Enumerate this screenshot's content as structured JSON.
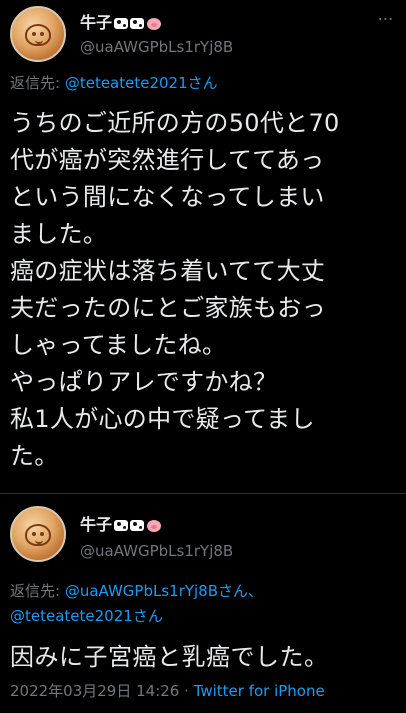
{
  "tweet1": {
    "name": "牛子",
    "handle": "@uaAWGPbLs1rYj8B",
    "reply_prefix": "返信先: ",
    "reply_to": "@teteatete2021",
    "reply_suffix": "さん",
    "lines": [
      "うちのご近所の方の50代と70",
      "代が癌が突然進行しててあっ",
      "という間になくなってしまい",
      "ました。",
      "癌の症状は落ち着いてて大丈",
      "夫だったのにとご家族もおっ",
      "しゃってましたね。",
      "やっぱりアレですかね？",
      "私1人が心の中で疑ってまし",
      "た。"
    ]
  },
  "tweet2": {
    "name": "牛子",
    "handle": "@uaAWGPbLs1rYj8B",
    "reply_prefix": "返信先: ",
    "reply_to_1": "@uaAWGPbLs1rYj8B",
    "reply_mid": "さん、",
    "reply_to_2": "@teteatete2021",
    "reply_suffix": "さん",
    "text": "因みに子宮癌と乳癌でした。",
    "timestamp": "2022年03月29日 14:26",
    "separator": " · ",
    "source": "Twitter for iPhone"
  },
  "icons": {
    "more": "more-options-icon",
    "avatar": "avatar-doraemon-icon",
    "emoji_cow": "cow-emoji",
    "emoji_pig": "pig-emoji"
  },
  "colors": {
    "background": "#000000",
    "text": "#e7e9ea",
    "muted": "#71767b",
    "link": "#1d9bf0"
  }
}
